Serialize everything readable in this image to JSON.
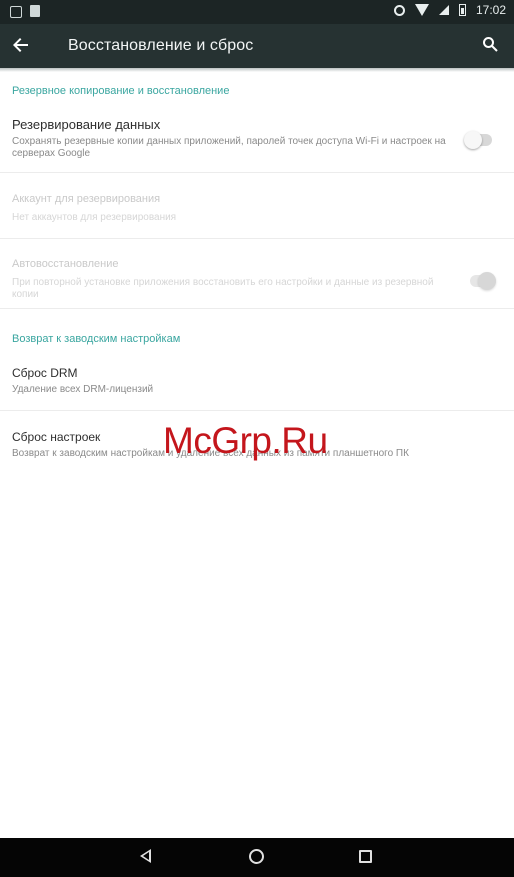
{
  "status_bar": {
    "time": "17:02"
  },
  "app_bar": {
    "title": "Восстановление и сброс"
  },
  "sections": [
    {
      "header": "Резервное копирование и восстановление",
      "items": [
        {
          "title": "Резервирование данных",
          "subtitle": "Сохранять резервные копии данных приложений, паролей точек доступа Wi-Fi и настроек на серверах Google",
          "switch": "off",
          "enabled": true
        },
        {
          "title": "Аккаунт для резервирования",
          "subtitle": "Нет аккаунтов для резервирования",
          "enabled": false
        },
        {
          "title": "Автовосстановление",
          "subtitle": "При повторной установке приложения восстановить его настройки и данные из резервной копии",
          "switch": "off",
          "enabled": false
        }
      ]
    },
    {
      "header": "Возврат к заводским настройкам",
      "items": [
        {
          "title": "Сброс DRM",
          "subtitle": "Удаление всех DRM-лицензий",
          "enabled": true
        },
        {
          "title": "Сброс настроек",
          "subtitle": "Возврат к заводским настройкам и удаление всех данных из памяти планшетного ПК",
          "enabled": true
        }
      ]
    }
  ],
  "watermark": "McGrp.Ru",
  "colors": {
    "accent": "#3aa6a0",
    "app_bar": "#263232",
    "status_bar": "#1c2525"
  }
}
